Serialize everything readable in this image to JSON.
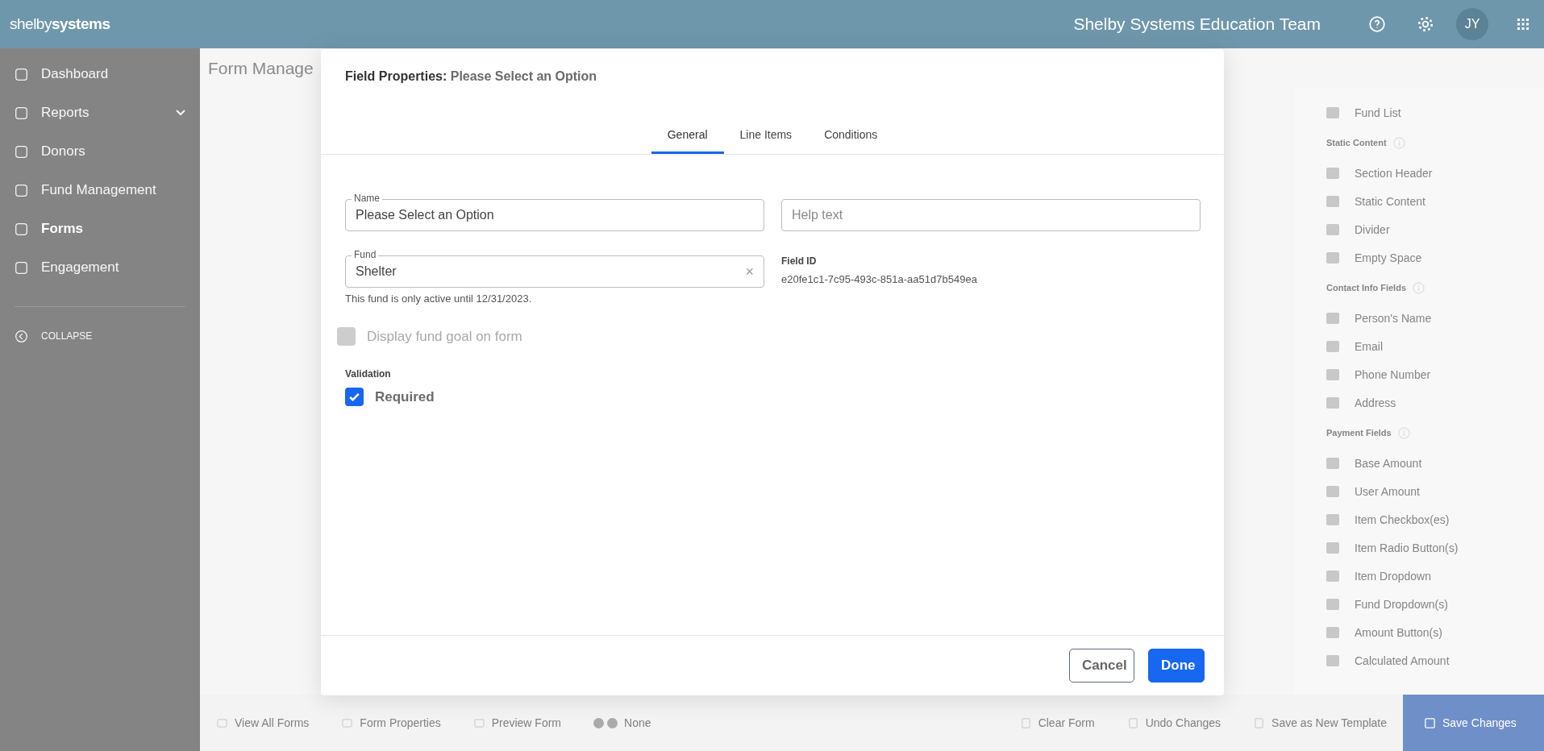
{
  "header": {
    "logo_light": "shelby",
    "logo_bold": "systems",
    "org_name": "Shelby Systems Education Team",
    "avatar_initials": "JY"
  },
  "sidebar": {
    "items": [
      {
        "label": "Dashboard",
        "selected": false,
        "has_submenu": false
      },
      {
        "label": "Reports",
        "selected": false,
        "has_submenu": true
      },
      {
        "label": "Donors",
        "selected": false,
        "has_submenu": false
      },
      {
        "label": "Fund Management",
        "selected": false,
        "has_submenu": false
      },
      {
        "label": "Forms",
        "selected": true,
        "has_submenu": false
      },
      {
        "label": "Engagement",
        "selected": false,
        "has_submenu": false
      }
    ],
    "collapse_label": "COLLAPSE"
  },
  "page_title": "Form Manage",
  "palette": {
    "partial_item": "Fund List",
    "sections": [
      {
        "title": "Static Content",
        "items": [
          "Section Header",
          "Static Content",
          "Divider",
          "Empty Space"
        ]
      },
      {
        "title": "Contact Info Fields",
        "items": [
          "Person's Name",
          "Email",
          "Phone Number",
          "Address"
        ]
      },
      {
        "title": "Payment Fields",
        "items": [
          "Base Amount",
          "User Amount",
          "Item Checkbox(es)",
          "Item Radio Button(s)",
          "Item Dropdown",
          "Fund Dropdown(s)",
          "Amount Button(s)",
          "Calculated Amount"
        ]
      }
    ]
  },
  "modal": {
    "title_label": "Field Properties:",
    "title_value": "Please Select an Option",
    "tabs": [
      {
        "label": "General",
        "selected": true
      },
      {
        "label": "Line Items",
        "selected": false
      },
      {
        "label": "Conditions",
        "selected": false
      }
    ],
    "name_field": {
      "label": "Name",
      "value": "Please Select an Option"
    },
    "help_field": {
      "placeholder": "Help text"
    },
    "fund_field": {
      "label": "Fund",
      "value": "Shelter",
      "clear_glyph": "×",
      "hint": "This fund is only active until 12/31/2023."
    },
    "field_id": {
      "label": "Field ID",
      "value": "e20fe1c1-7c95-493c-851a-aa51d7b549ea"
    },
    "display_goal": {
      "label": "Display fund goal on form",
      "checked": false,
      "disabled": true
    },
    "validation_label": "Validation",
    "required": {
      "label": "Required",
      "checked": true,
      "disabled": false
    },
    "buttons": [
      {
        "label": "Cancel",
        "kind": "secondary"
      },
      {
        "label": "Done",
        "kind": "primary"
      }
    ]
  },
  "bottom_bar": {
    "left": [
      "View All Forms",
      "Form Properties",
      "Preview Form"
    ],
    "toggle_label": "None",
    "right": [
      "Clear Form",
      "Undo Changes",
      "Save as New Template"
    ],
    "save": "Save Changes"
  }
}
